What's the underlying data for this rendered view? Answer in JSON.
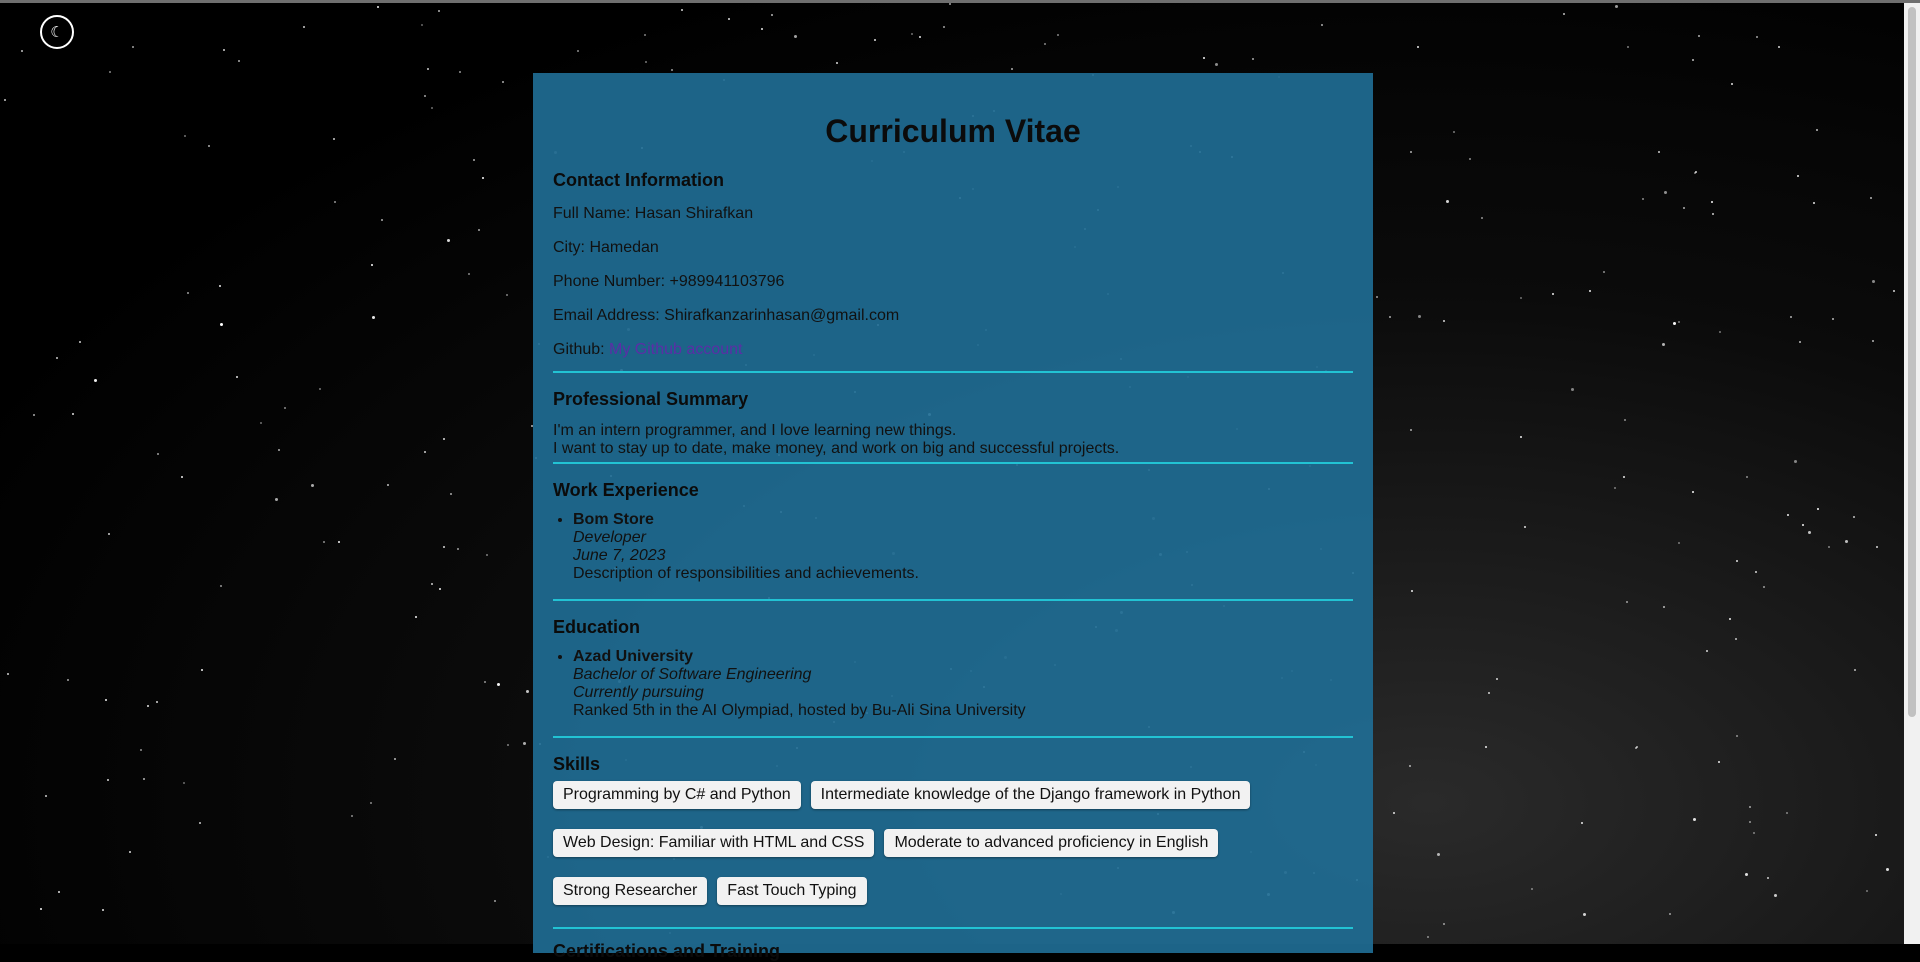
{
  "theme_toggle": {
    "icon": "moon-icon",
    "glyph": "☾"
  },
  "title": "Curriculum Vitae",
  "contact": {
    "heading": "Contact Information",
    "full_name": "Full Name: Hasan Shirafkan",
    "city": "City: Hamedan",
    "phone": "Phone Number: +989941103796",
    "email": "Email Address: Shirafkanzarinhasan@gmail.com",
    "github_label": "Github: ",
    "github_link": "My Github account"
  },
  "summary": {
    "heading": "Professional Summary",
    "line1": "I'm an intern programmer, and I love learning new things.",
    "line2": "I want to stay up to date, make money, and work on big and successful projects."
  },
  "work": {
    "heading": "Work Experience",
    "items": [
      {
        "company": "Bom Store",
        "role": "Developer",
        "date": "June 7, 2023",
        "desc": "Description of responsibilities and achievements."
      }
    ]
  },
  "education": {
    "heading": "Education",
    "items": [
      {
        "school": "Azad University",
        "degree": "Bachelor of Software Engineering",
        "status": "Currently pursuing",
        "note": "Ranked 5th in the AI Olympiad, hosted by Bu-Ali Sina University"
      }
    ]
  },
  "skills": {
    "heading": "Skills",
    "items": [
      "Programming by C# and Python",
      "Intermediate knowledge of the Django framework in Python",
      "Web Design: Familiar with HTML and CSS",
      "Moderate to advanced proficiency in English",
      "Strong Researcher",
      "Fast Touch Typing"
    ]
  },
  "certifications": {
    "heading": "Certifications and Training"
  },
  "colors": {
    "card": "#1f6c94",
    "separator": "#22c3d4",
    "link": "#5b2ea6"
  }
}
